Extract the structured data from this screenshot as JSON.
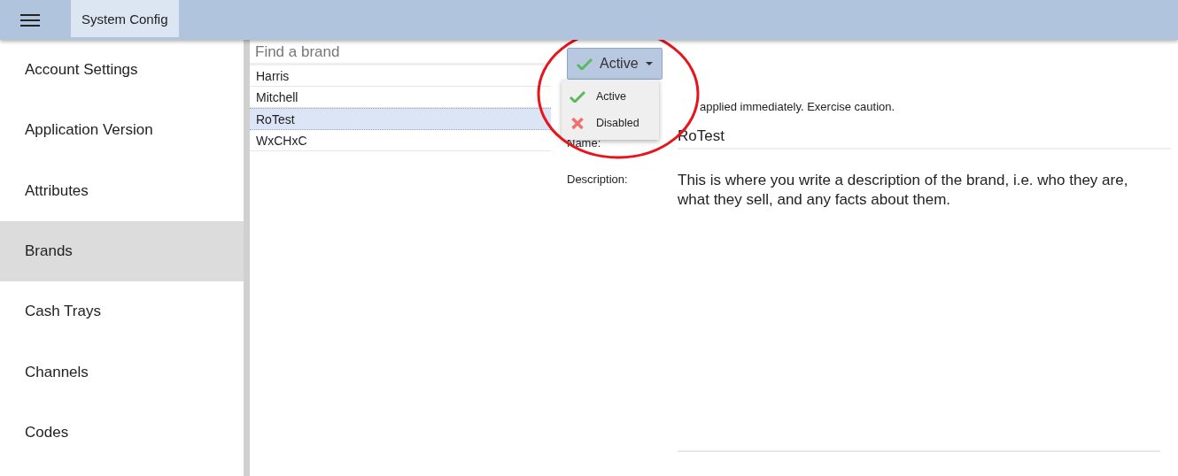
{
  "header": {
    "title": "System Config"
  },
  "sidebar": {
    "items": [
      {
        "label": "Account Settings",
        "selected": false
      },
      {
        "label": "Application Version",
        "selected": false
      },
      {
        "label": "Attributes",
        "selected": false
      },
      {
        "label": "Brands",
        "selected": true
      },
      {
        "label": "Cash Trays",
        "selected": false
      },
      {
        "label": "Channels",
        "selected": false
      },
      {
        "label": "Codes",
        "selected": false
      }
    ]
  },
  "brand_list": {
    "search": {
      "placeholder": "Find a brand"
    },
    "rows": [
      {
        "label": "Harris",
        "selected": false
      },
      {
        "label": "Mitchell",
        "selected": false
      },
      {
        "label": "RoTest",
        "selected": true
      },
      {
        "label": "WxCHxC",
        "selected": false
      }
    ]
  },
  "detail": {
    "status_button": {
      "label": "Active",
      "kind": "active"
    },
    "status_menu": {
      "expanded": true,
      "options": [
        {
          "label": "Active",
          "kind": "active"
        },
        {
          "label": "Disabled",
          "kind": "disabled"
        }
      ]
    },
    "warning": "applied immediately. Exercise caution.",
    "fields": [
      {
        "label": "Name:",
        "value": "RoTest",
        "kind": "line"
      },
      {
        "label": "Description:",
        "value": "This is where you write a description of the brand, i.e. who they are, what they sell, and any facts about them.",
        "kind": "area"
      }
    ]
  }
}
